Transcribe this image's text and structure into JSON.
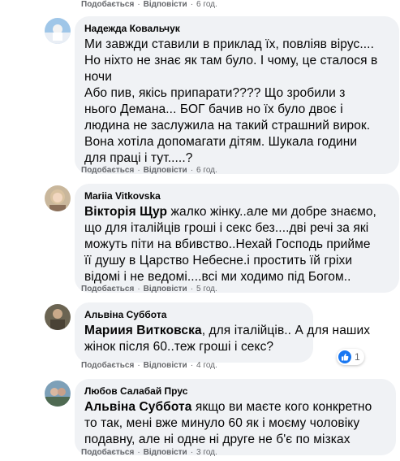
{
  "actions": {
    "like": "Подобається",
    "reply": "Відповісти",
    "separator": "·"
  },
  "top_row": {
    "time": "6 год."
  },
  "comments": [
    {
      "author": "Надежда Ковальчук",
      "lines": [
        "Ми завжди ставили в приклад їх, повліяв вірус....",
        "Но ніхто не знає як там було. І чому, це сталося в",
        "ночи",
        "Або пив, якісь припарати???? Що зробили з",
        "нього Демана... БОГ бачив но їх було двоє і",
        "людина не заслужила на такий страшний вирок.",
        "Вона хотіла допомагати дітям. Шукала години",
        "для праці і тут.....?"
      ],
      "time": "6 год."
    },
    {
      "author": "Mariia Vitkovska",
      "mention": "Вікторія Щур",
      "lines": [
        " жалко жінку..але ми добре знаємо,",
        "що для італійців гроші і секс без....дві речі за які",
        "можуть піти на вбивство..Нехай Господь прийме",
        "її душу в Царство Небесне.і простить їй гріхи",
        "відомі і не ведомі....всі ми ходимо під Богом.."
      ],
      "time": "5 год."
    },
    {
      "author": "Альвіна Суббота",
      "mention": "Мариия Витковска",
      "lines": [
        ", для італійців.. А для наших",
        "жінок після 60..теж гроші і секс?"
      ],
      "time": "4 год.",
      "reactions": {
        "icon": "like-icon",
        "count": "1",
        "color": "#1877f2"
      }
    },
    {
      "author": "Любов Салабай Прус",
      "mention": "Альвіна Суббота",
      "lines": [
        " якщо ви маєте кого конкретно",
        "то так, мені вже минуло 60 як і моєму чоловіку",
        "подавну, але ні одне ні друге не б'є по мізках"
      ],
      "time": "3 год."
    }
  ]
}
